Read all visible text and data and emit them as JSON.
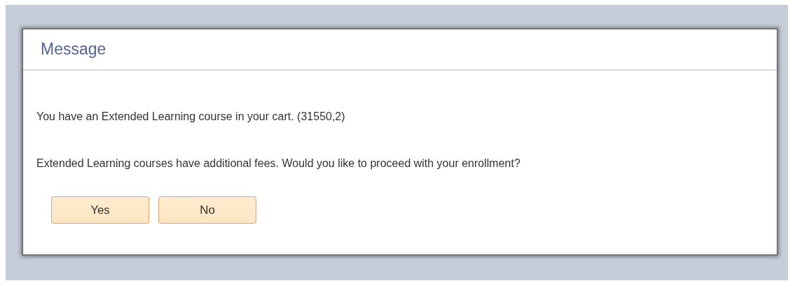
{
  "dialog": {
    "title": "Message",
    "messages": [
      "You have an Extended Learning course in your cart. (31550,2)",
      "Extended Learning courses have additional fees. Would you like to proceed with your enrollment?"
    ],
    "buttons": [
      "Yes",
      "No"
    ]
  }
}
